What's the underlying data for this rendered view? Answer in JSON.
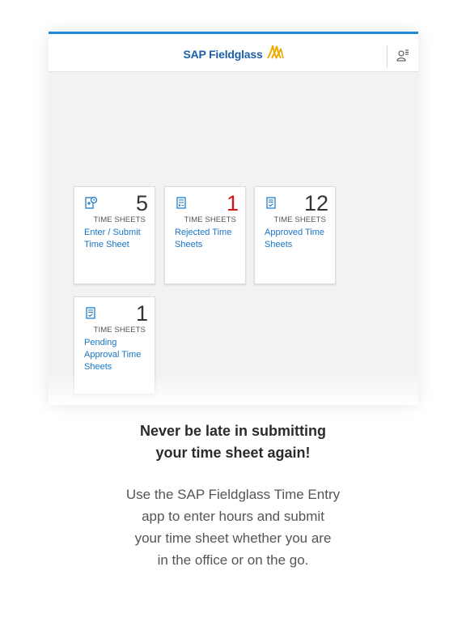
{
  "header": {
    "brand": "SAP Fieldglass",
    "user_icon": "user-menu-icon"
  },
  "colors": {
    "accent_bar": "#1f8ad8",
    "brand_text": "#1d5fa8",
    "link": "#1874c5",
    "rejected_count": "#d8121d"
  },
  "tiles": [
    {
      "icon": "document-clock-icon",
      "count": "5",
      "subtitle": "TIME SHEETS",
      "title_lines": [
        "Enter / Submit",
        "Time Sheet"
      ]
    },
    {
      "icon": "checklist-x-icon",
      "count": "1",
      "subtitle": "TIME SHEETS",
      "title_lines": [
        "Rejected Time",
        "Sheets"
      ]
    },
    {
      "icon": "document-check-icon",
      "count": "12",
      "subtitle": "TIME SHEETS",
      "title_lines": [
        "Approved Time",
        "Sheets"
      ]
    },
    {
      "icon": "document-check-icon",
      "count": "1",
      "subtitle": "TIME SHEETS",
      "title_lines": [
        "Pending",
        "Approval Time",
        "Sheets"
      ]
    }
  ],
  "promo": {
    "headline_lines": [
      "Never be late in submitting",
      "your time sheet again!"
    ],
    "body_lines": [
      "Use the SAP Fieldglass Time Entry",
      "app to enter hours and submit",
      "your time sheet whether you are",
      "in the office or on the go."
    ]
  }
}
